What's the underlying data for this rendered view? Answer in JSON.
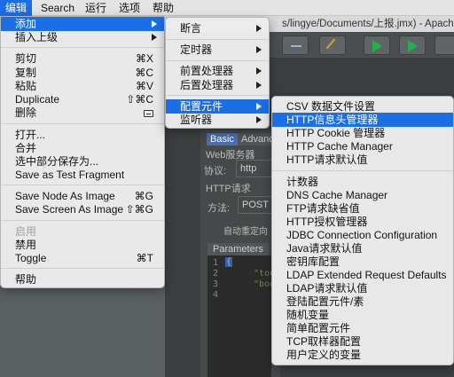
{
  "menubar": {
    "items": [
      "编辑",
      "Search",
      "运行",
      "选项",
      "帮助"
    ]
  },
  "window": {
    "title": "s/lingye/Documents/上报.jmx) - Apache JMe"
  },
  "edit_menu": {
    "items": [
      {
        "label": "添加",
        "shortcut": "",
        "submenu": true,
        "highlighted": true
      },
      {
        "label": "插入上级",
        "shortcut": "",
        "submenu": true
      },
      {
        "label": "剪切",
        "shortcut": "⌘X"
      },
      {
        "label": "复制",
        "shortcut": "⌘C"
      },
      {
        "label": "粘贴",
        "shortcut": "⌘V"
      },
      {
        "label": "Duplicate",
        "shortcut": "⇧⌘C"
      },
      {
        "label": "删除",
        "shortcut": "delete-key-icon"
      },
      {
        "label": "打开...",
        "shortcut": ""
      },
      {
        "label": "合并",
        "shortcut": ""
      },
      {
        "label": "选中部分保存为...",
        "shortcut": ""
      },
      {
        "label": "Save as Test Fragment",
        "shortcut": ""
      },
      {
        "label": "Save Node As Image",
        "shortcut": "⌘G"
      },
      {
        "label": "Save Screen As Image",
        "shortcut": "⇧⌘G"
      },
      {
        "label": "启用",
        "shortcut": "",
        "disabled": true
      },
      {
        "label": "禁用",
        "shortcut": ""
      },
      {
        "label": "Toggle",
        "shortcut": "⌘T"
      },
      {
        "label": "帮助",
        "shortcut": ""
      }
    ]
  },
  "add_menu": {
    "items": [
      {
        "label": "断言"
      },
      {
        "label": "定时器"
      },
      {
        "label": "前置处理器"
      },
      {
        "label": "后置处理器"
      },
      {
        "label": "配置元件",
        "highlighted": true
      },
      {
        "label": "监听器"
      }
    ]
  },
  "config_menu": {
    "items": [
      {
        "label": "CSV 数据文件设置"
      },
      {
        "label": "HTTP信息头管理器",
        "highlighted": true
      },
      {
        "label": "HTTP Cookie 管理器"
      },
      {
        "label": "HTTP Cache Manager"
      },
      {
        "label": "HTTP请求默认值"
      },
      {
        "label": "计数器"
      },
      {
        "label": "DNS Cache Manager"
      },
      {
        "label": "FTP请求缺省值"
      },
      {
        "label": "HTTP授权管理器"
      },
      {
        "label": "JDBC Connection Configuration"
      },
      {
        "label": "Java请求默认值"
      },
      {
        "label": "密钥库配置"
      },
      {
        "label": "LDAP Extended Request Defaults"
      },
      {
        "label": "LDAP请求默认值"
      },
      {
        "label": "登陆配置元件/素"
      },
      {
        "label": "随机变量"
      },
      {
        "label": "简单配置元件"
      },
      {
        "label": "TCP取样器配置"
      },
      {
        "label": "用户定义的变量"
      }
    ]
  },
  "background": {
    "tabs": [
      "Basic",
      "Advanc"
    ],
    "web_server_label": "Web服务器",
    "protocol_label": "协议:",
    "protocol_value": "http",
    "http_request_label": "HTTP请求",
    "method_label": "方法:",
    "method_value": "POST",
    "redirect_label": "自动重定向",
    "parameters_tab": "Parameters",
    "line_numbers": [
      "1",
      "2",
      "3",
      "4"
    ],
    "code_lines": [
      "\"tou",
      "\"boo"
    ],
    "brace": "{"
  }
}
